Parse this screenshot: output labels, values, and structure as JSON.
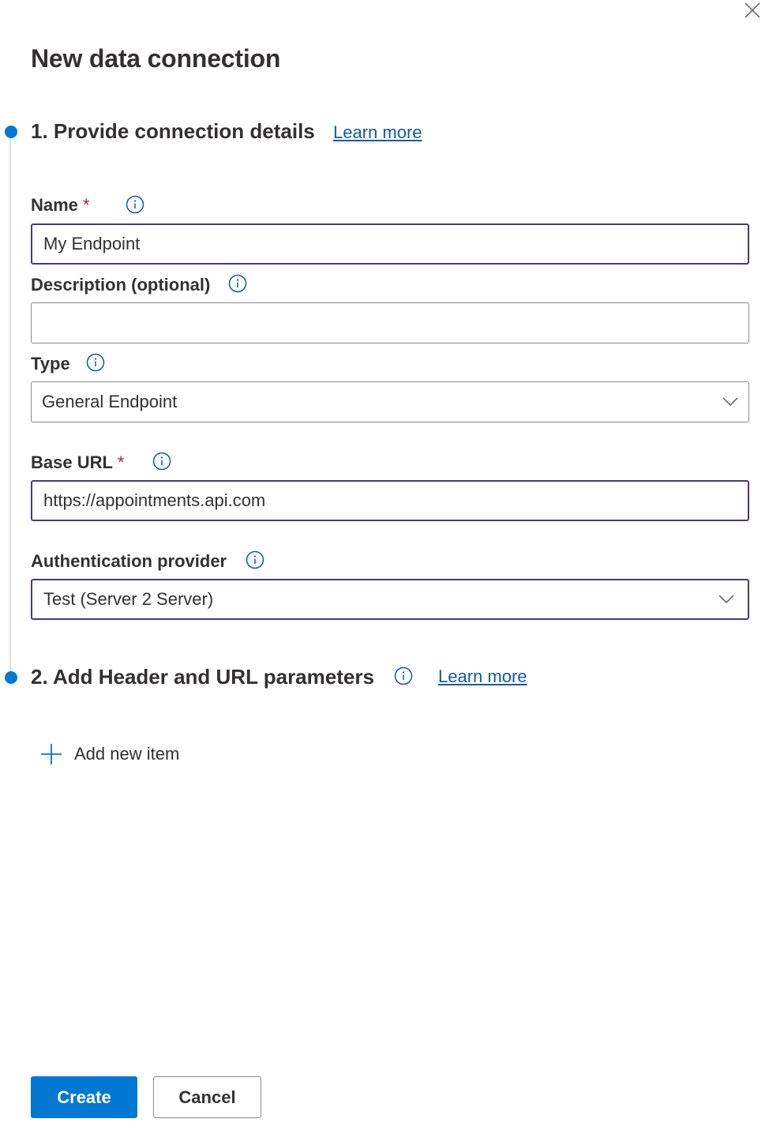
{
  "dialog": {
    "title": "New data connection",
    "close_icon": "close-icon"
  },
  "accent_color": "#0078d4",
  "steps": [
    {
      "title": "1. Provide connection details",
      "learn_more": "Learn more"
    },
    {
      "title": "2. Add Header and URL parameters",
      "learn_more": "Learn more",
      "add_item_label": "Add new item"
    }
  ],
  "form": {
    "name": {
      "label": "Name",
      "required_mark": "*",
      "value": "My Endpoint"
    },
    "description": {
      "label": "Description (optional)",
      "value": ""
    },
    "type": {
      "label": "Type",
      "selected": "General Endpoint"
    },
    "base_url": {
      "label": "Base URL",
      "required_mark": "*",
      "value": "https://appointments.api.com"
    },
    "auth_provider": {
      "label": "Authentication provider",
      "selected": "Test (Server 2 Server)"
    }
  },
  "footer": {
    "create_label": "Create",
    "cancel_label": "Cancel"
  }
}
